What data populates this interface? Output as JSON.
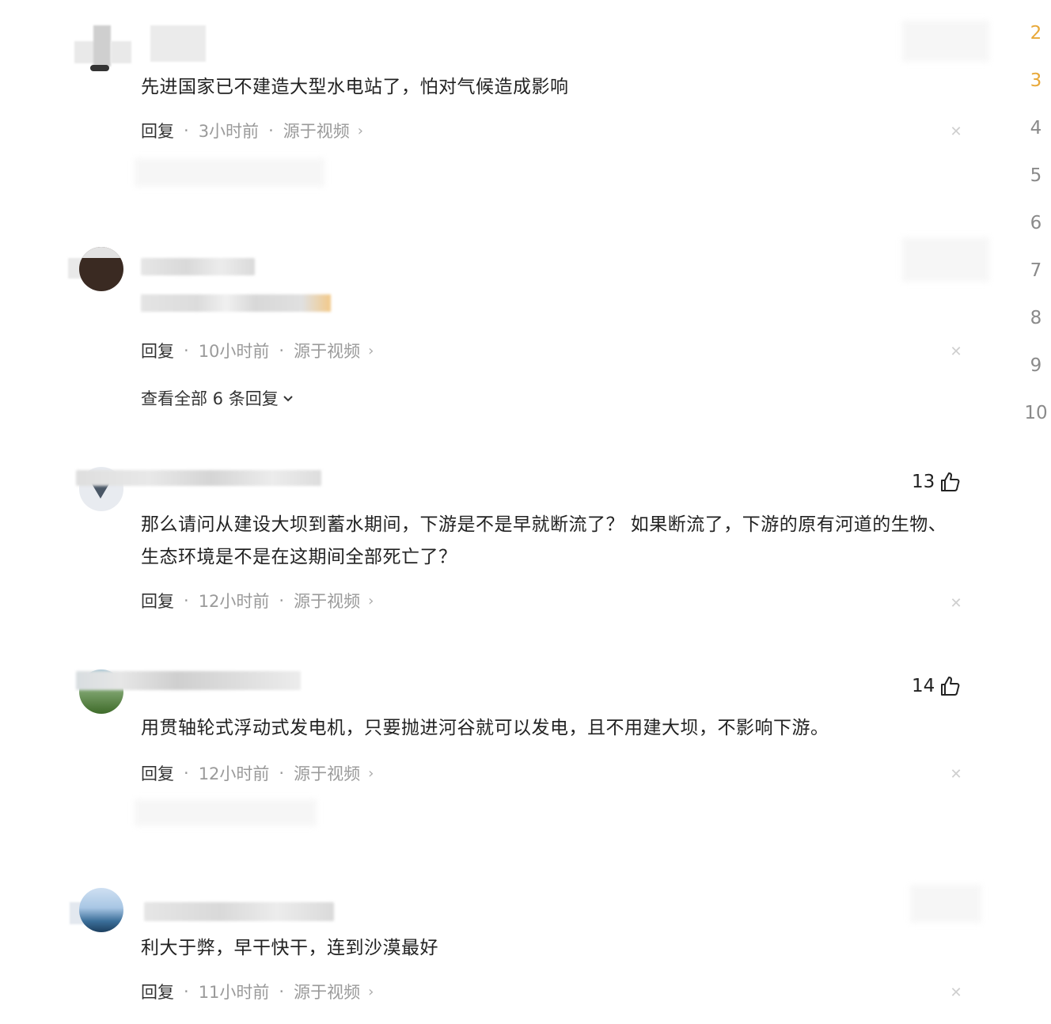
{
  "comments": [
    {
      "text": "先进国家已不建造大型水电站了，怕对气候造成影响",
      "reply_label": "回复",
      "time": "3小时前",
      "source": "源于视频",
      "likes": ""
    },
    {
      "text": "",
      "reply_label": "回复",
      "time": "10小时前",
      "source": "源于视频",
      "likes": "",
      "view_all": "查看全部 6 条回复"
    },
    {
      "text": "那么请问从建设大坝到蓄水期间，下游是不是早就断流了？ 如果断流了，下游的原有河道的生物、生态环境是不是在这期间全部死亡了？",
      "reply_label": "回复",
      "time": "12小时前",
      "source": "源于视频",
      "likes": "13"
    },
    {
      "text": "用贯轴轮式浮动式发电机，只要抛进河谷就可以发电，且不用建大坝，不影响下游。",
      "reply_label": "回复",
      "time": "12小时前",
      "source": "源于视频",
      "likes": "14"
    },
    {
      "text": "利大于弊，早干快干，连到沙漠最好",
      "reply_label": "回复",
      "time": "11小时前",
      "source": "源于视频",
      "likes": ""
    }
  ],
  "scroll_numbers": [
    "2",
    "3",
    "4",
    "5",
    "6",
    "7",
    "8",
    "9",
    "10"
  ],
  "colors": {
    "text": "#222222",
    "meta": "#9a9a9a",
    "highlight": "#e8a838",
    "close": "#cfcfcf"
  },
  "icons": {
    "like": "thumbs-up-icon",
    "close": "close-icon",
    "chevron": "chevron-right-icon",
    "expand": "chevron-down-icon"
  }
}
